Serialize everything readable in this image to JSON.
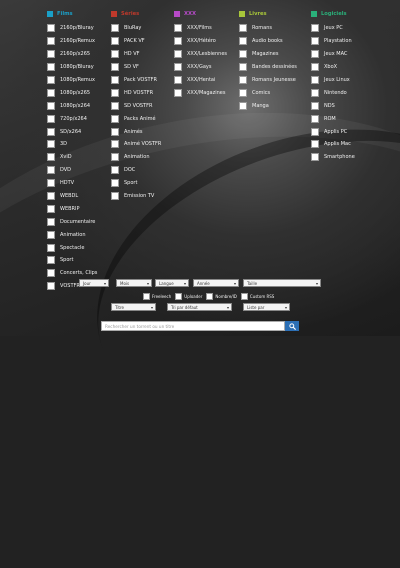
{
  "colors": {
    "films": "#1aa0c8",
    "series": "#c0392b",
    "xxx": "#b74ac8",
    "livres": "#a8c63a",
    "logiciels": "#2ab07a",
    "search_button": "#2c6fb5"
  },
  "columns": [
    {
      "title": "Films",
      "color_key": "films",
      "items": [
        "2160p/Bluray",
        "2160p/Remux",
        "2160p/x265",
        "1080p/Bluray",
        "1080p/Remux",
        "1080p/x265",
        "1080p/x264",
        "720p/x264",
        "SD/x264",
        "3D",
        "XviD",
        "DVD",
        "HDTV",
        "WEBDL",
        "WEBRIP",
        "Documentaire",
        "Animation",
        "Spectacle",
        "Sport",
        "Concerts, Clips",
        "VOSTFR"
      ]
    },
    {
      "title": "Séries",
      "color_key": "series",
      "items": [
        "BluRay",
        "PACK VF",
        "HD VF",
        "SD VF",
        "Pack VOSTFR",
        "HD VOSTFR",
        "SD VOSTFR",
        "Packs Animé",
        "Animés",
        "Animé VOSTFR",
        "Animation",
        "DOC",
        "Sport",
        "Emission TV"
      ]
    },
    {
      "title": "XXX",
      "color_key": "xxx",
      "items": [
        "XXX/Films",
        "XXX/Hétéro",
        "XXX/Lesbiennes",
        "XXX/Gays",
        "XXX/Hentai",
        "XXX/Magazines"
      ]
    },
    {
      "title": "Livres",
      "color_key": "livres",
      "items": [
        "Romans",
        "Audio books",
        "Magazines",
        "Bandes dessinées",
        "Romans Jeunesse",
        "Comics",
        "Manga"
      ]
    },
    {
      "title": "Logiciels",
      "color_key": "logiciels",
      "items": [
        "Jeux PC",
        "Playstation",
        "Jeux MAC",
        "XboX",
        "Jeux Linux",
        "Nintendo",
        "NDS",
        "ROM",
        "Applis PC",
        "Applis Mac",
        "Smartphone"
      ]
    }
  ],
  "filters": {
    "row1": [
      "Jour",
      "Mois",
      "Langue",
      "Année",
      "Taille"
    ],
    "row2": [
      "Titre",
      "Tri par défaut",
      "Liste par"
    ]
  },
  "options": [
    "Freeleech",
    "Uploader",
    "Nombre/ID",
    "Custom RSS"
  ],
  "search": {
    "placeholder": "Rechercher un torrent ou un titre",
    "button_icon": "search-icon"
  }
}
